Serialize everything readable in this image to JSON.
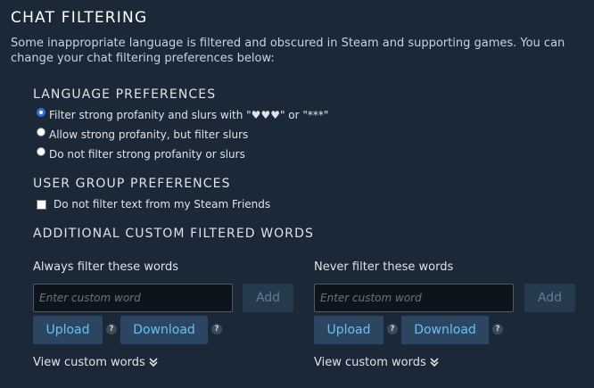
{
  "page": {
    "title": "CHAT FILTERING",
    "description": "Some inappropriate language is filtered and obscured in Steam and supporting games. You can change your chat filtering preferences below:"
  },
  "language_preferences": {
    "heading": "LANGUAGE PREFERENCES",
    "options": [
      {
        "label": "Filter strong profanity and slurs with \"♥♥♥\" or \"***\"",
        "selected": true
      },
      {
        "label": "Allow strong profanity, but filter slurs",
        "selected": false
      },
      {
        "label": "Do not filter strong profanity or slurs",
        "selected": false
      }
    ]
  },
  "user_group_preferences": {
    "heading": "USER GROUP PREFERENCES",
    "checkbox_label": "Do not filter text from my Steam Friends",
    "checked": false
  },
  "custom_words": {
    "heading": "ADDITIONAL CUSTOM FILTERED WORDS",
    "always": {
      "label": "Always filter these words",
      "placeholder": "Enter custom word",
      "add_label": "Add",
      "upload_label": "Upload",
      "download_label": "Download",
      "help_glyph": "?",
      "view_label": "View custom words"
    },
    "never": {
      "label": "Never filter these words",
      "placeholder": "Enter custom word",
      "add_label": "Add",
      "upload_label": "Upload",
      "download_label": "Download",
      "help_glyph": "?",
      "view_label": "View custom words"
    }
  },
  "colors": {
    "background": "#1b2838",
    "button_bg": "#2c4661",
    "button_text": "#66c0f4",
    "radio_selected": "#2e6fde"
  }
}
